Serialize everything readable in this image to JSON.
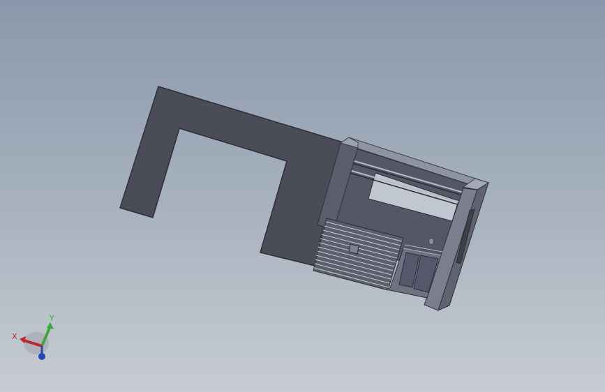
{
  "colors": {
    "background_top": "#8a98ab",
    "background_bottom": "#c7ccd2",
    "body_dark": "#4a4c57",
    "body_edge": "#2e2f36",
    "face_light": "#8e93a4",
    "face_mid": "#6b6f7e",
    "x_axis": "#c0262d",
    "y_axis": "#3aa93a",
    "z_axis": "#2747b8"
  },
  "triad": {
    "x_label": "X",
    "y_label": "Y"
  }
}
